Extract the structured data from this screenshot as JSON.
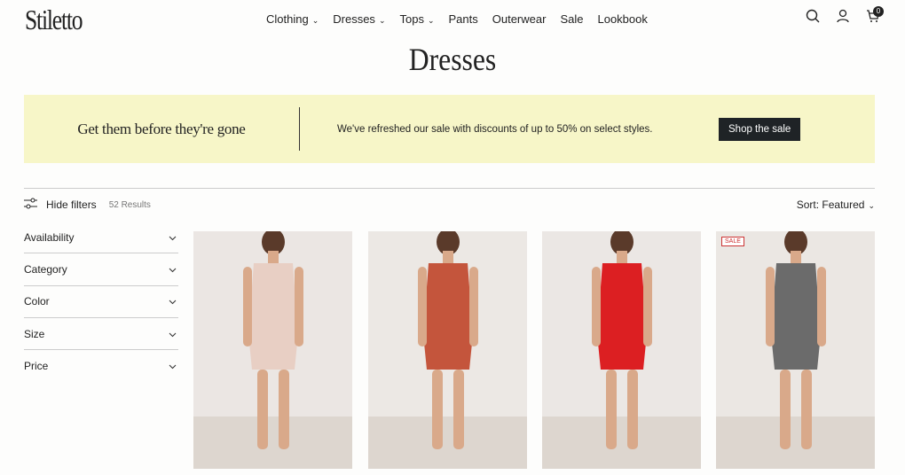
{
  "brand": "Stiletto",
  "nav": [
    {
      "label": "Clothing",
      "dropdown": true
    },
    {
      "label": "Dresses",
      "dropdown": true
    },
    {
      "label": "Tops",
      "dropdown": true
    },
    {
      "label": "Pants"
    },
    {
      "label": "Outerwear"
    },
    {
      "label": "Sale"
    },
    {
      "label": "Lookbook"
    }
  ],
  "cart_count": "0",
  "page_title": "Dresses",
  "banner": {
    "heading": "Get them before they're gone",
    "text": "We've refreshed our sale with discounts of up to 50% on select styles.",
    "button": "Shop the sale",
    "bg": "#f7f6c8"
  },
  "filters": {
    "toggle": "Hide filters",
    "results": "52 Results",
    "sort": "Sort: Featured",
    "items": [
      "Availability",
      "Category",
      "Color",
      "Size",
      "Price"
    ]
  },
  "products": [
    {
      "outfit_color": "#e8cfc4",
      "bg": "#ebe6e3",
      "badge": ""
    },
    {
      "outfit_color": "#c4553c",
      "bg": "#ece8e4",
      "badge": ""
    },
    {
      "outfit_color": "#dc1f22",
      "bg": "#ebe7e4",
      "badge": ""
    },
    {
      "outfit_color": "#6b6b6b",
      "bg": "#ebe7e3",
      "badge": "SALE"
    }
  ]
}
